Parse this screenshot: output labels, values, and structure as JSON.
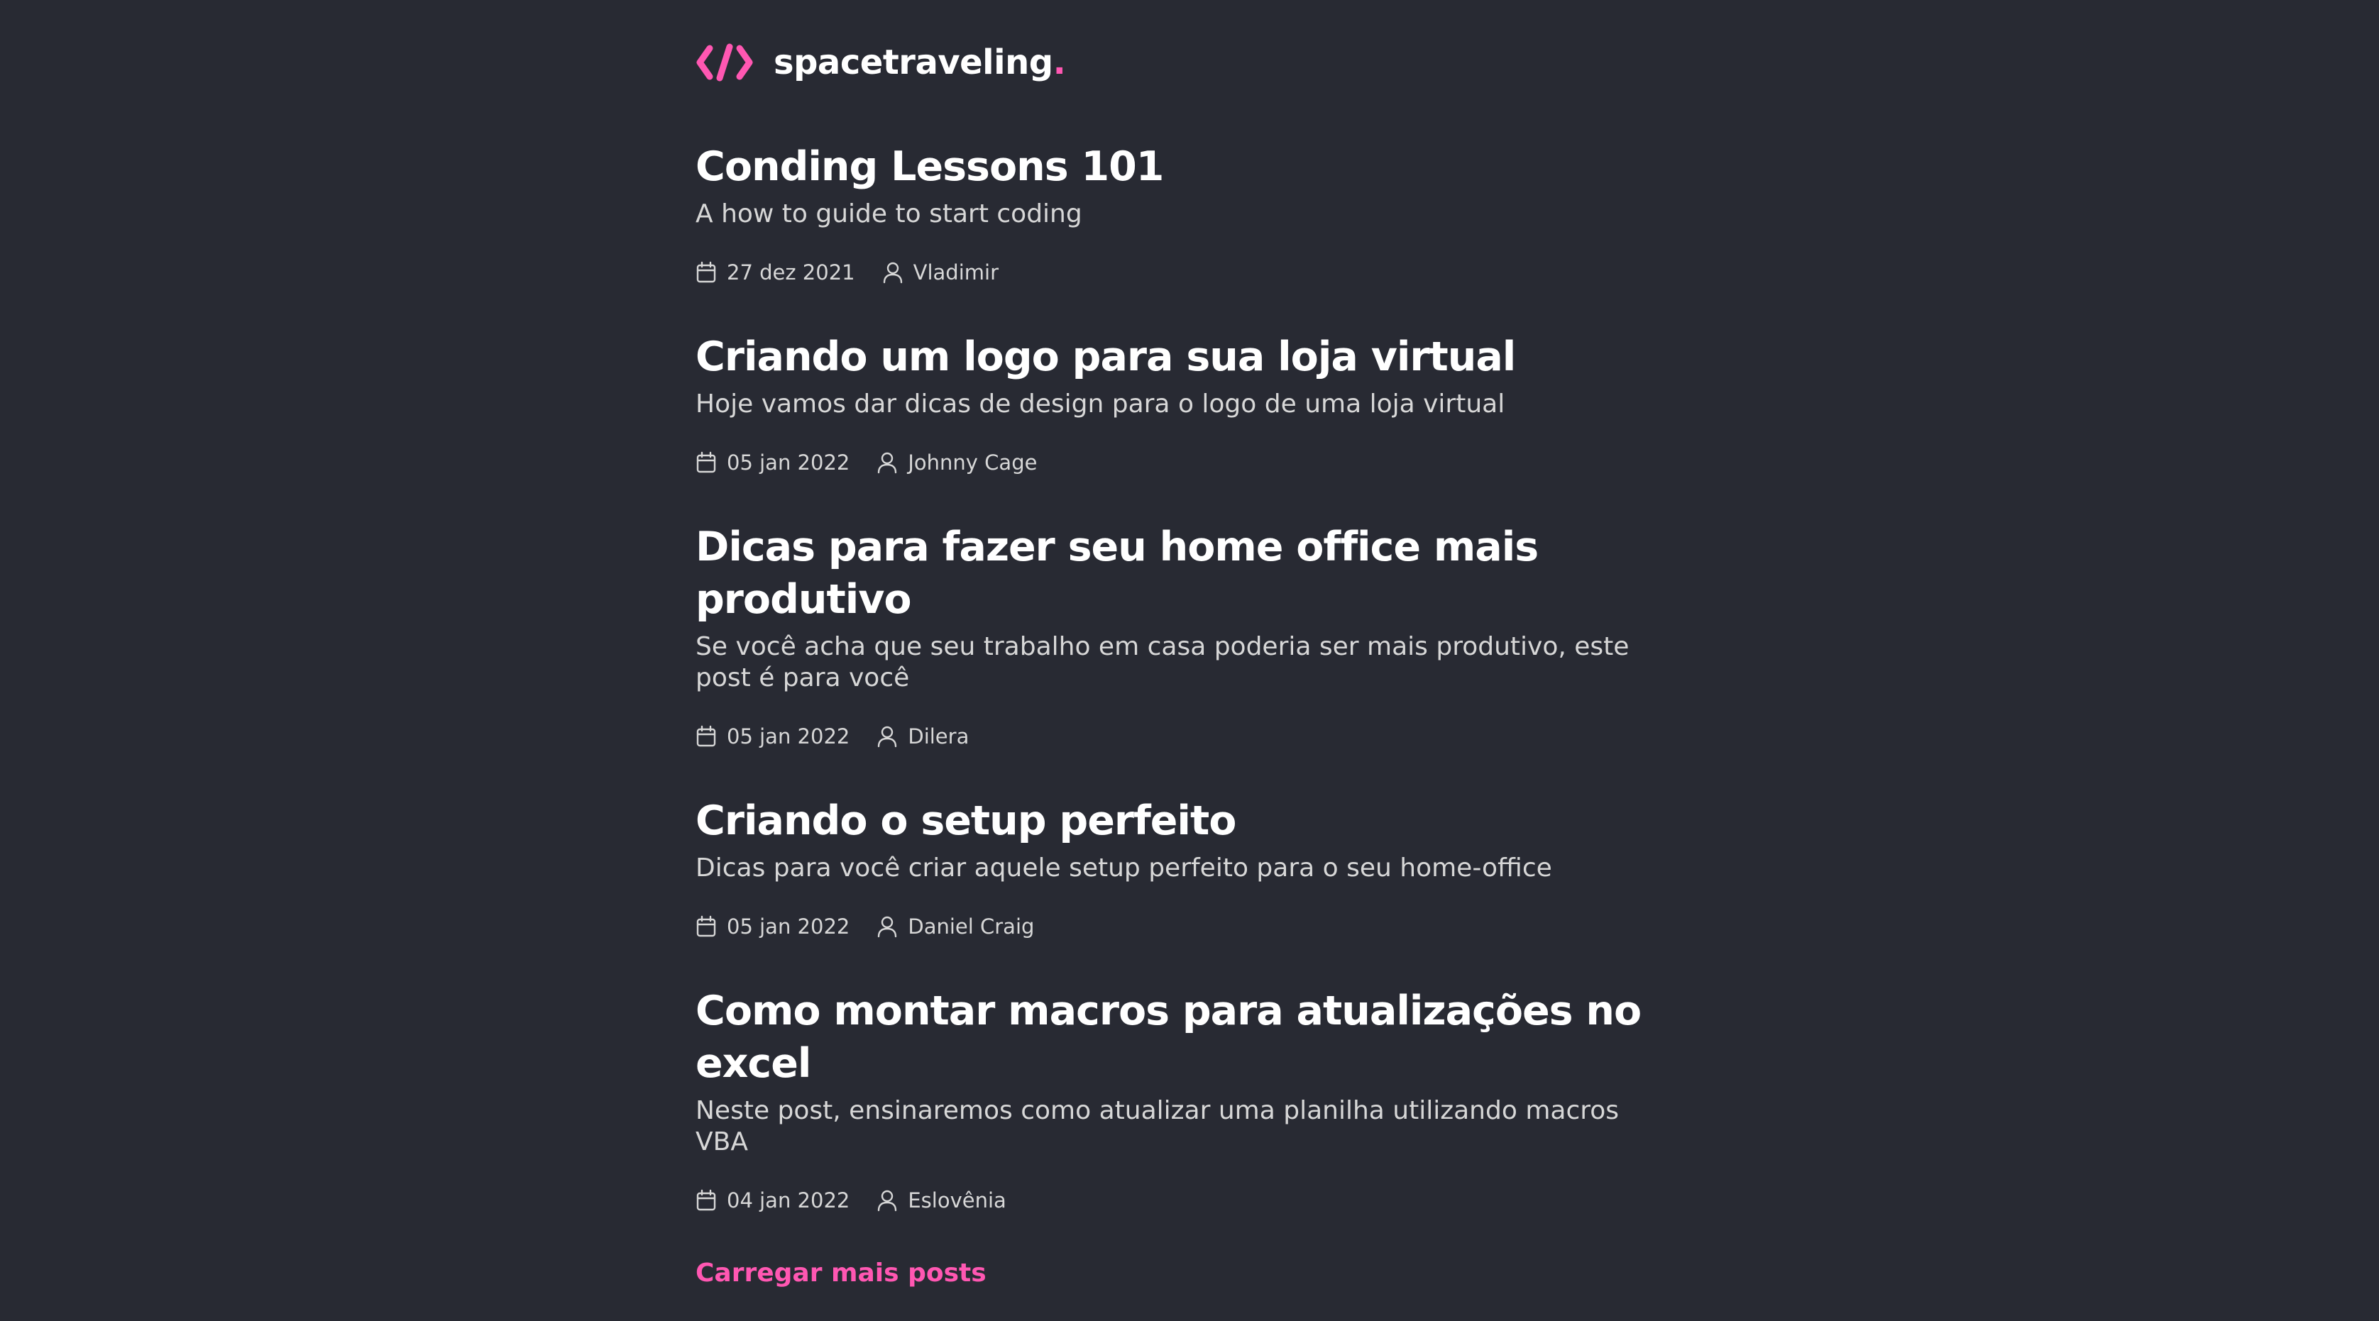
{
  "header": {
    "logo_text": "spacetraveling",
    "logo_dot": "."
  },
  "colors": {
    "background": "#282a33",
    "accent": "#ff57b2",
    "title": "#ffffff",
    "body_text": "#d7d7d7"
  },
  "icons": {
    "logo": "code-brackets-icon",
    "date": "calendar-icon",
    "author": "user-icon"
  },
  "posts": [
    {
      "title": "Conding Lessons 101",
      "subtitle": "A how to guide to start coding",
      "date": "27 dez 2021",
      "author": "Vladimir"
    },
    {
      "title": "Criando um logo para sua loja virtual",
      "subtitle": "Hoje vamos dar dicas de design para o logo de uma loja virtual",
      "date": "05 jan 2022",
      "author": "Johnny Cage"
    },
    {
      "title": "Dicas para fazer seu home office mais produtivo",
      "subtitle": "Se você acha que seu trabalho em casa poderia ser mais produtivo, este post é para você",
      "date": "05 jan 2022",
      "author": "Dilera"
    },
    {
      "title": "Criando o setup perfeito",
      "subtitle": "Dicas para você criar aquele setup perfeito para o seu home-office",
      "date": "05 jan 2022",
      "author": "Daniel Craig"
    },
    {
      "title": "Como montar macros para atualizações no excel",
      "subtitle": "Neste post, ensinaremos como atualizar uma planilha utilizando macros VBA",
      "date": "04 jan 2022",
      "author": "Eslovênia"
    }
  ],
  "load_more_label": "Carregar mais posts"
}
